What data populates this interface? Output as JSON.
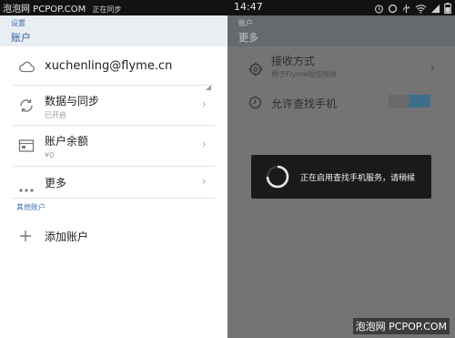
{
  "status_bar": {
    "left_text": "泡泡网 PCPOP.COM",
    "notification": "正在同步",
    "time": "14:47",
    "icons": [
      "alarm-icon",
      "circle-icon",
      "usb-icon",
      "wifi-icon",
      "signal-icon",
      "battery-icon"
    ]
  },
  "left_pane": {
    "header": {
      "small": "设置",
      "title": "账户"
    },
    "account_email": "xuchenling@flyme.cn",
    "items": [
      {
        "label": "数据与同步",
        "sub": "已开启",
        "icon": "sync-icon"
      },
      {
        "label": "账户余额",
        "sub": "¥0",
        "icon": "wallet-icon"
      },
      {
        "label": "更多",
        "sub": "",
        "icon": "more-dots-icon"
      }
    ],
    "other_accounts_label": "其他账户",
    "add_account_label": "添加账户"
  },
  "right_pane": {
    "header": {
      "small": "账户",
      "title": "更多"
    },
    "items": [
      {
        "label": "接收方式",
        "sub": "用于Flyme短信接收",
        "icon": "gear-icon"
      },
      {
        "label": "允许查找手机",
        "sub": "",
        "icon": "clock-icon"
      }
    ],
    "toggle_on": true
  },
  "toast": {
    "text": "正在启用查找手机服务，请稍候"
  },
  "watermark": "泡泡网 PCPOP.COM",
  "colors": {
    "accent": "#2a5f9e",
    "header_bg": "#e9eef2",
    "overlay": "#747474",
    "toast_bg": "#1a1a1a"
  }
}
